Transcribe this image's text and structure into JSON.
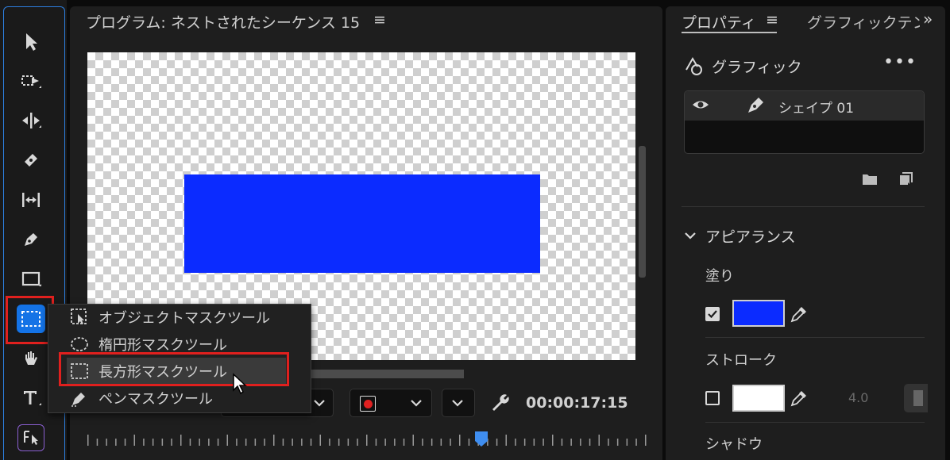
{
  "monitor": {
    "title": "プログラム: ネストされたシーケンス 15",
    "menu_glyph": "≡",
    "timecode": "00:00:17:15"
  },
  "flyout": {
    "items": [
      {
        "label": "オブジェクトマスクツール",
        "icon": "object-mask-icon"
      },
      {
        "label": "楕円形マスクツール",
        "icon": "ellipse-mask-icon"
      },
      {
        "label": "長方形マスクツール",
        "icon": "rectangle-mask-icon",
        "selected": true
      },
      {
        "label": "ペンマスクツール",
        "icon": "pen-mask-icon"
      }
    ]
  },
  "properties": {
    "tab_label": "プロパティ",
    "tab_menu": "≡",
    "tab2_label": "グラフィックテンプレート",
    "overflow": "»",
    "section": "グラフィック",
    "more": "•••",
    "layer_name": "シェイプ 01",
    "appearance": "アピアランス",
    "fill_label": "塗り",
    "fill_color": "#0b2bff",
    "fill_checked": true,
    "stroke_label": "ストローク",
    "stroke_color": "#ffffff",
    "stroke_checked": false,
    "stroke_width": "4.0",
    "shadow_label": "シャドウ"
  },
  "colors": {
    "accent": "#1473e6",
    "highlight": "#e0201e",
    "shape": "#0b2bff"
  }
}
